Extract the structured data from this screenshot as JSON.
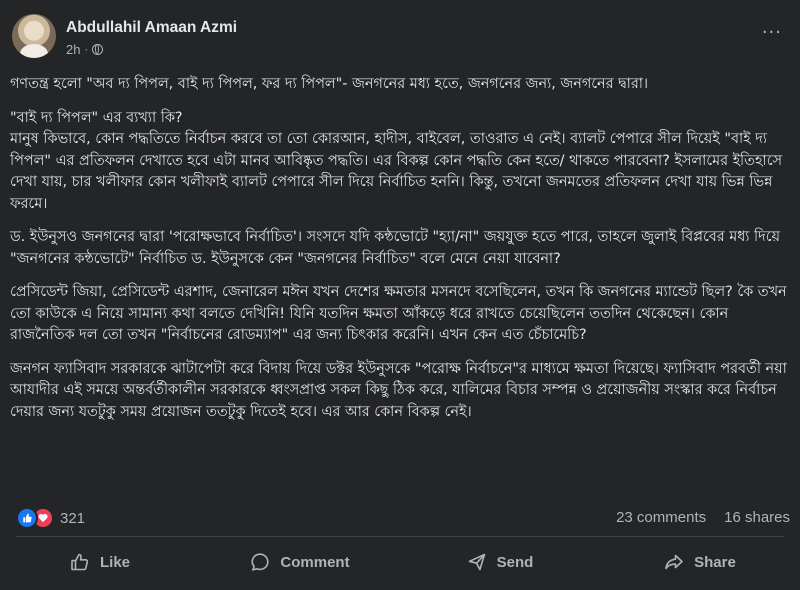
{
  "header": {
    "author": "Abdullahil Amaan Azmi",
    "time": "2h",
    "separator": "·",
    "privacy_icon": "globe-icon",
    "more_icon": "more-options-icon",
    "more_label": "···"
  },
  "post": {
    "paragraphs": [
      "গণতন্ত্র হলো \"অব দ্য পিপল, বাই দ্য পিপল, ফর দ্য পিপল\"- জনগনের মধ্য হতে, জনগনের জন্য, জনগনের দ্বারা।",
      "\"বাই দ্য পিপল\" এর ব্যখ্যা কি?\nমানুষ কিভাবে, কোন পদ্ধতিতে নির্বাচন করবে তা তো কোরআন, হাদীস, বাইবেল, তাওরাত এ নেই। ব্যালট পেপারে সীল দিয়েই \"বাই দ্য পিপল\" এর প্রতিফলন দেখাতে হবে এটা মানব আবিষ্কৃত পদ্ধতি। এর বিকল্প কোন পদ্ধতি কেন হতে/ থাকতে পারবেনা? ইসলামের ইতিহাসে দেখা যায়, চার খলীফার কোন খলীফাই ব্যালট পেপারে সীল দিয়ে নির্বাচিত হননি। কিন্তু, তখনো জনমতের প্রতিফলন দেখা যায় ভিন্ন ভিন্ন ফরমে।",
      "ড. ইউনুসও জনগনের দ্বারা 'পরোক্ষভাবে নির্বাচিত'। সংসদে যদি কন্ঠভোটে \"হ্যা/না\" জয়যুক্ত হতে পারে, তাহলে জুলাই বিপ্লবের মধ্য দিয়ে  \"জনগনের কন্ঠভোটে\" নির্বাচিত ড. ইউনুসকে কেন \"জনগনের নির্বাচিত\" বলে মেনে নেয়া যাবেনা?",
      "প্রেসিডেন্ট জিয়া, প্রেসিডেন্ট এরশাদ, জেনারেল মঈন যখন দেশের ক্ষমতার মসনদে বসেছিলেন, তখন কি জনগনের ম্যান্ডেট ছিল? কৈ তখন তো কাউকে এ নিয়ে সামান্য কথা বলতে দেখিনি! যিনি যতদিন ক্ষমতা আঁকড়ে ধরে রাখতে চেয়েছিলেন ততদিন থেকেছেন। কোন রাজনৈতিক দল তো তখন \"নির্বাচনের রোডম্যাপ\" এর জন্য চিৎকার করেনি। এখন কেন এত চেঁচামেচি?",
      "জনগন ফ্যাসিবাদ সরকারকে ঝাটাপেটা করে বিদায় দিয়ে ডক্টর ইউনুসকে \"পরোক্ষ নির্বাচনে\"র মাধ্যমে ক্ষমতা দিয়েছে। ফ্যাসিবাদ পরবর্তী নয়া আযাদীর এই সময়ে অন্তর্বর্তীকালীন সরকারকে ধ্বংসপ্রাপ্ত সকল কিছু ঠিক করে, যালিমের বিচার সম্পন্ন ও প্রয়োজনীয় সংস্কার করে নির্বাচন দেয়ার জন্য যতটুকু সময় প্রয়োজন ততটুকু দিতেই হবে। এর আর কোন বিকল্প নেই।"
    ]
  },
  "stats": {
    "reaction_icons": [
      "like-reaction-icon",
      "love-reaction-icon"
    ],
    "reaction_count": "321",
    "comments": "23 comments",
    "shares": "16 shares"
  },
  "actions": {
    "like": "Like",
    "comment": "Comment",
    "send": "Send",
    "share": "Share"
  },
  "colors": {
    "background": "#242526",
    "text_primary": "#e4e6eb",
    "text_secondary": "#b0b3b8",
    "like_blue": "#1877f2",
    "love_red": "#f33e58",
    "divider": "#3e4042"
  }
}
